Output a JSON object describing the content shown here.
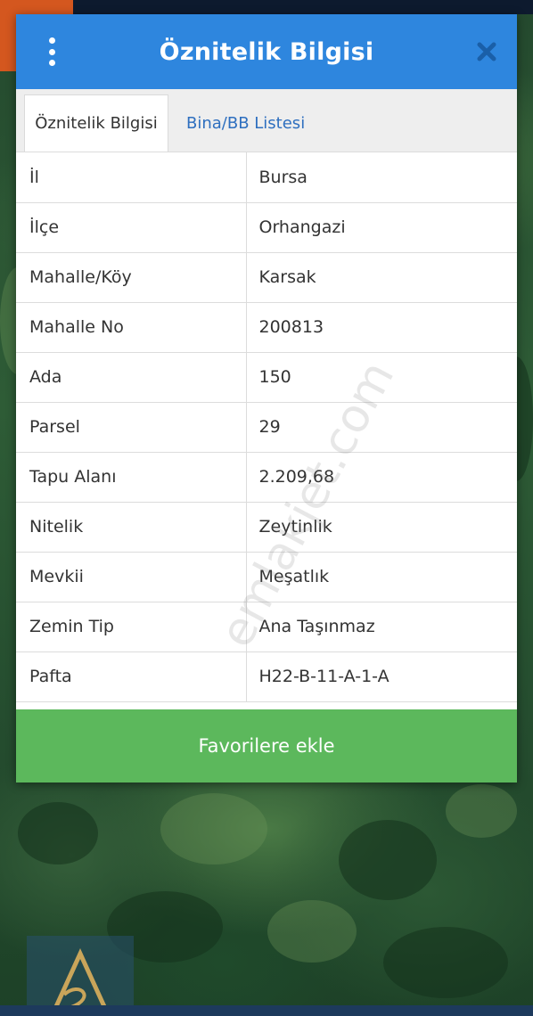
{
  "dialog": {
    "title": "Öznitelik Bilgisi",
    "tabs": [
      {
        "label": "Öznitelik Bilgisi",
        "active": true
      },
      {
        "label": "Bina/BB Listesi",
        "active": false
      }
    ],
    "rows": [
      {
        "label": "İl",
        "value": "Bursa"
      },
      {
        "label": "İlçe",
        "value": "Orhangazi"
      },
      {
        "label": "Mahalle/Köy",
        "value": "Karsak"
      },
      {
        "label": "Mahalle No",
        "value": "200813"
      },
      {
        "label": "Ada",
        "value": "150"
      },
      {
        "label": "Parsel",
        "value": "29"
      },
      {
        "label": "Tapu Alanı",
        "value": "2.209,68"
      },
      {
        "label": "Nitelik",
        "value": "Zeytinlik"
      },
      {
        "label": "Mevkii",
        "value": "Meşatlık"
      },
      {
        "label": "Zemin Tip",
        "value": "Ana Taşınmaz"
      },
      {
        "label": "Pafta",
        "value": "H22-B-11-A-1-A"
      }
    ],
    "favorite_button": "Favorilere ekle",
    "icons": {
      "menu": "more-vert-icon",
      "close": "close-icon"
    }
  },
  "watermark": "emlakjet.com",
  "colors": {
    "header": "#2e86de",
    "favorite_button": "#5cb85c",
    "tab_link": "#2e6fbf"
  }
}
